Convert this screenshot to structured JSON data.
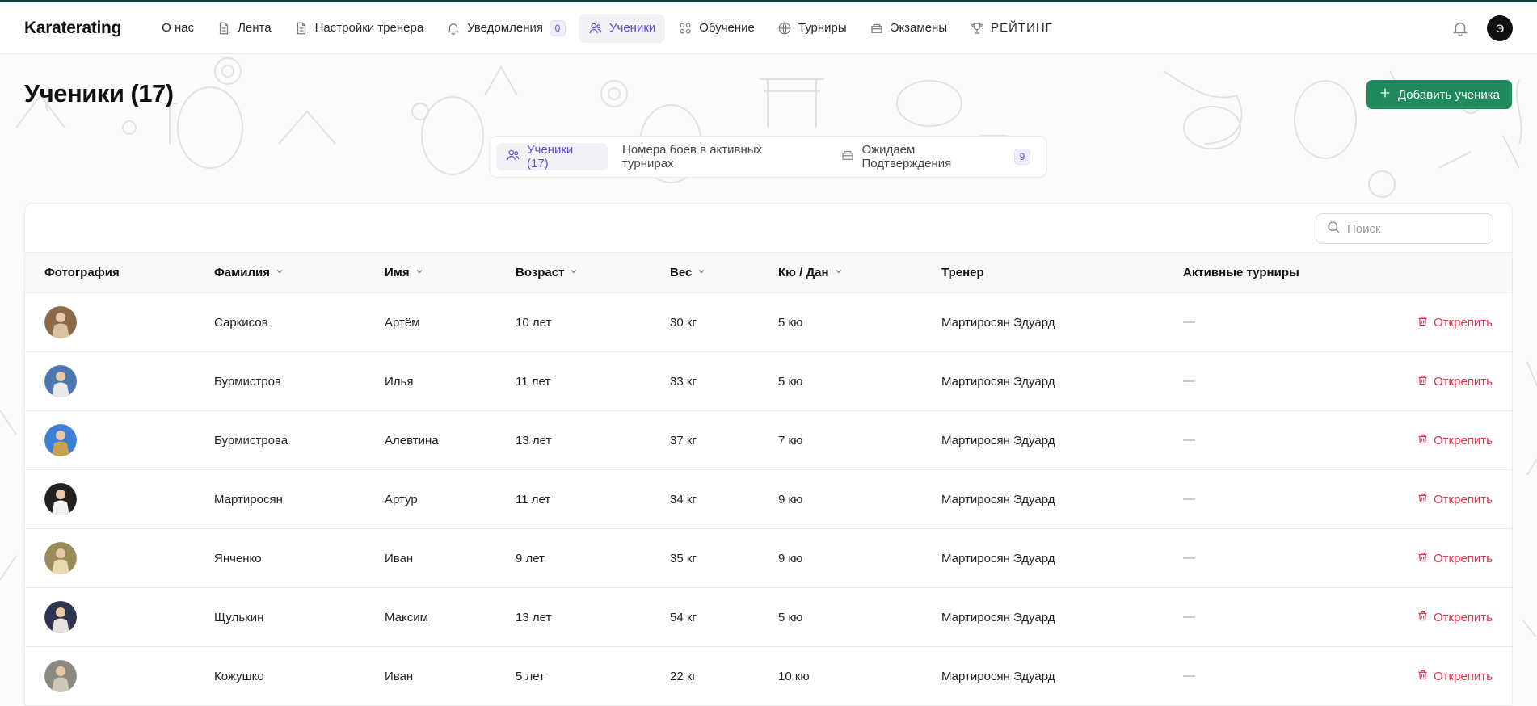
{
  "header": {
    "logo": "Karaterating",
    "nav": [
      {
        "label": "О нас",
        "icon": "",
        "badge": ""
      },
      {
        "label": "Лента",
        "icon": "document-icon",
        "badge": ""
      },
      {
        "label": "Настройки тренера",
        "icon": "document-icon",
        "badge": ""
      },
      {
        "label": "Уведомления",
        "icon": "bell-icon",
        "badge": "0"
      },
      {
        "label": "Ученики",
        "icon": "users-icon",
        "badge": "",
        "active": true
      },
      {
        "label": "Обучение",
        "icon": "grid-icon",
        "badge": ""
      },
      {
        "label": "Турниры",
        "icon": "globe-icon",
        "badge": ""
      },
      {
        "label": "Экзамены",
        "icon": "belt-icon",
        "badge": ""
      },
      {
        "label": "РЕЙТИНГ",
        "icon": "trophy-icon",
        "badge": ""
      }
    ],
    "avatar_letter": "Э"
  },
  "page": {
    "title": "Ученики (17)",
    "add_button": "Добавить ученика"
  },
  "tabs": [
    {
      "label": "Ученики (17)",
      "icon": "users-icon",
      "badge": "",
      "active": true
    },
    {
      "label": "Номера боев в активных турнирах",
      "icon": "",
      "badge": ""
    },
    {
      "label": "Ожидаем Подтверждения",
      "icon": "belt-icon",
      "badge": "9"
    }
  ],
  "search": {
    "placeholder": "Поиск",
    "value": ""
  },
  "table": {
    "columns": [
      "Фотография",
      "Фамилия",
      "Имя",
      "Возраст",
      "Вес",
      "Кю / Дан",
      "Тренер",
      "Активные турниры"
    ],
    "action_label": "Открепить",
    "rows": [
      {
        "surname": "Саркисов",
        "name": "Артём",
        "age": "10 лет",
        "weight": "30 кг",
        "rank": "5 кю",
        "coach": "Мартиросян Эдуард",
        "tournaments": "—"
      },
      {
        "surname": "Бурмистров",
        "name": "Илья",
        "age": "11 лет",
        "weight": "33 кг",
        "rank": "5 кю",
        "coach": "Мартиросян Эдуард",
        "tournaments": "—"
      },
      {
        "surname": "Бурмистрова",
        "name": "Алевтина",
        "age": "13 лет",
        "weight": "37 кг",
        "rank": "7 кю",
        "coach": "Мартиросян Эдуард",
        "tournaments": "—"
      },
      {
        "surname": "Мартиросян",
        "name": "Артур",
        "age": "11 лет",
        "weight": "34 кг",
        "rank": "9 кю",
        "coach": "Мартиросян Эдуард",
        "tournaments": "—"
      },
      {
        "surname": "Янченко",
        "name": "Иван",
        "age": "9 лет",
        "weight": "35 кг",
        "rank": "9 кю",
        "coach": "Мартиросян Эдуард",
        "tournaments": "—"
      },
      {
        "surname": "Щулькин",
        "name": "Максим",
        "age": "13 лет",
        "weight": "54 кг",
        "rank": "5 кю",
        "coach": "Мартиросян Эдуард",
        "tournaments": "—"
      },
      {
        "surname": "Кожушко",
        "name": "Иван",
        "age": "5 лет",
        "weight": "22 кг",
        "rank": "10 кю",
        "coach": "Мартиросян Эдуард",
        "tournaments": "—"
      }
    ]
  },
  "colors": {
    "accent": "#5b4fd8",
    "primary_button": "#1f8a5b",
    "danger": "#e0344d"
  }
}
